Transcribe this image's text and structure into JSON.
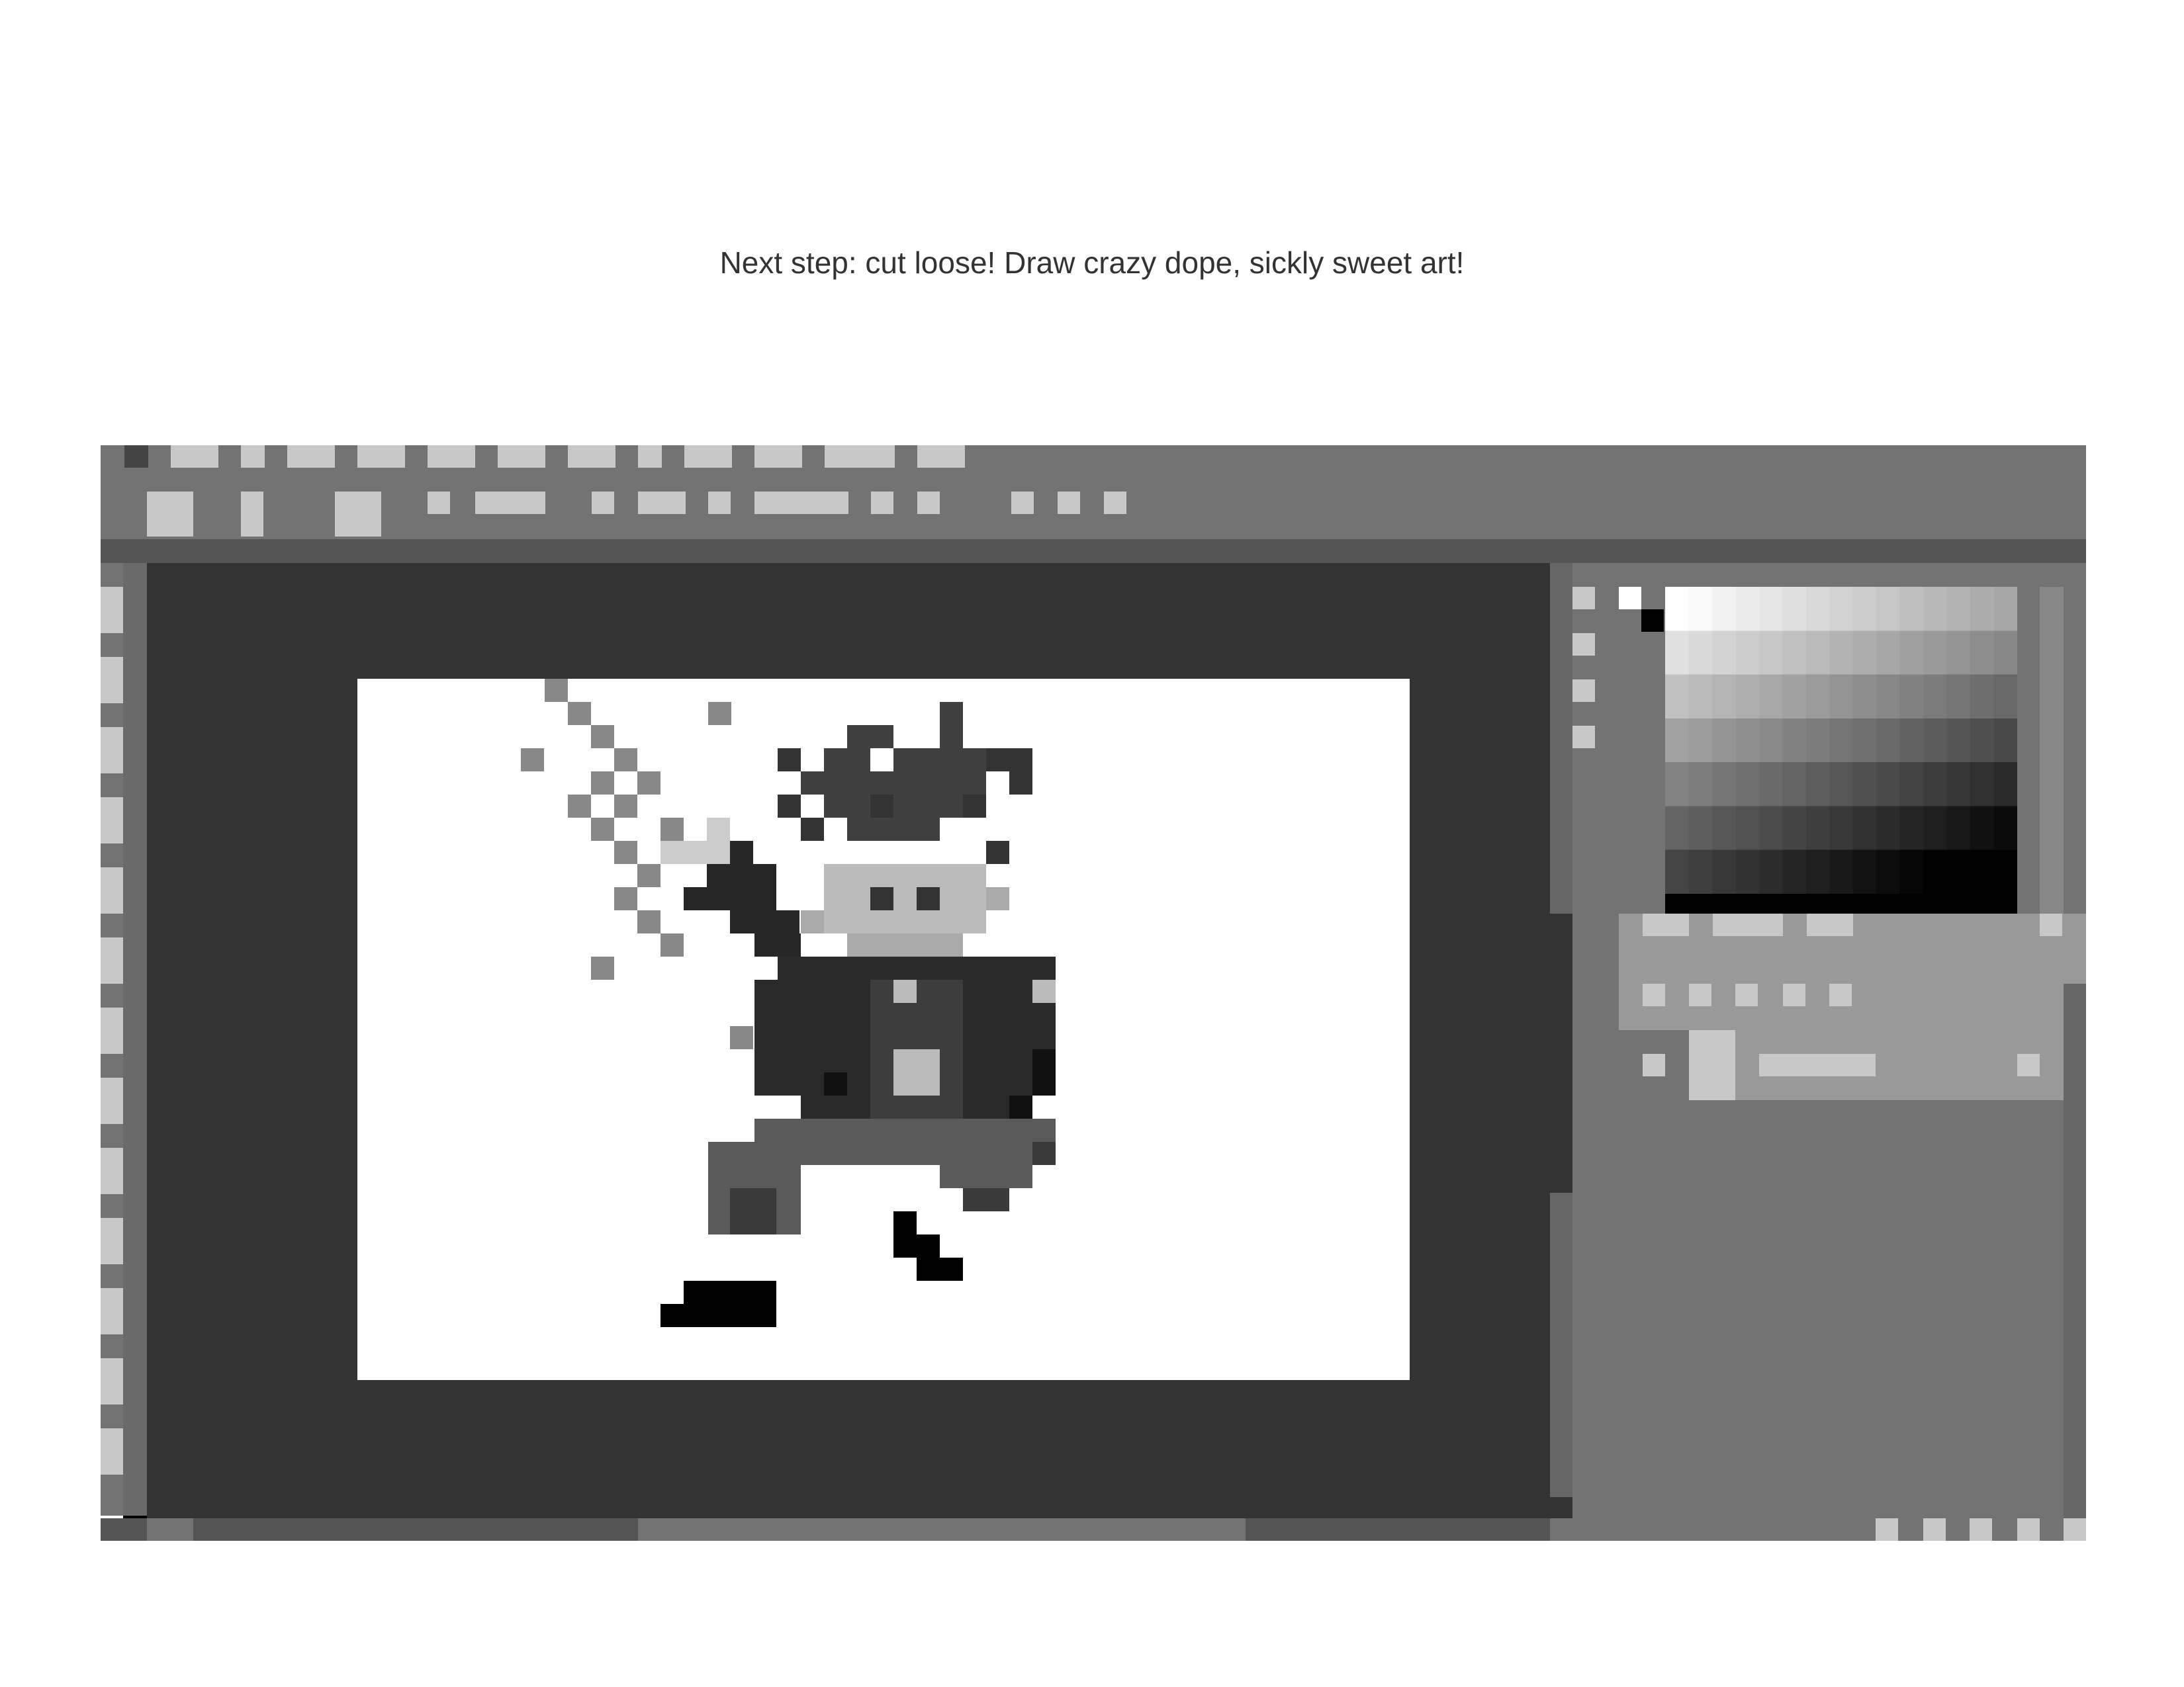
{
  "caption": "Next step: cut loose! Draw crazy dope, sickly sweet art!",
  "app": {
    "menu_bar": {
      "item_count": 13
    },
    "options_bar": {
      "tool_count": 11
    },
    "tools_panel": {
      "tool_count": 13
    },
    "document": {
      "subject": "pixel-art character with spiky hair swinging a sparkle"
    },
    "color_panel": {
      "swatch_grid": "grayscale 15x8"
    },
    "colors": {
      "app_bg": "#737373",
      "workspace": "#333333",
      "canvas": "#ffffff",
      "ui_light": "#c8c8c8",
      "ui_dark": "#555555"
    }
  }
}
